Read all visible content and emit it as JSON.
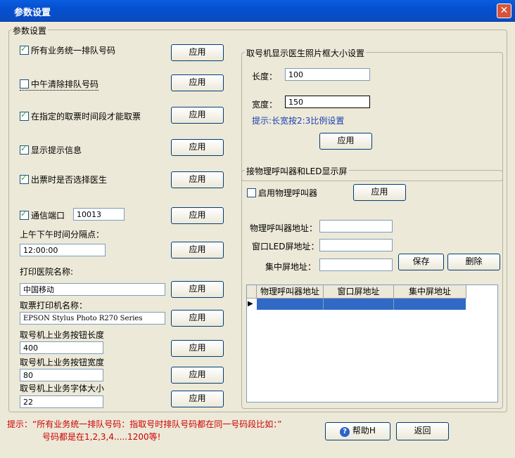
{
  "window": {
    "title": "参数设置",
    "close": "✕"
  },
  "left": {
    "group_label": "参数设置",
    "checks": [
      {
        "label": "所有业务统一排队号码",
        "checked": true
      },
      {
        "label": "中午清除排队号码",
        "checked": false
      },
      {
        "label": "在指定的取票时间段才能取票",
        "checked": true
      },
      {
        "label": "显示提示信息",
        "checked": true
      },
      {
        "label": "出票时是否选择医生",
        "checked": true
      },
      {
        "label": "通信端口",
        "checked": true
      }
    ],
    "port_value": "10013",
    "apply": "应用",
    "split_label": "上午下午时间分隔点：",
    "split_value": "12:00:00",
    "hospital_label": "打印医院名称:",
    "hospital_value": "中国移动",
    "printer_label": "取票打印机名称：",
    "printer_value": "EPSON Stylus Photo R270 Series",
    "btn_len_label": "取号机上业务按钮长度",
    "btn_len_value": "400",
    "btn_wid_label": "取号机上业务按钮宽度",
    "btn_wid_value": "80",
    "font_label": "取号机上业务字体大小",
    "font_value": "22"
  },
  "photo": {
    "group_label": "取号机显示医生照片框大小设置",
    "length_label": "长度：",
    "length_value": "100",
    "width_label": "宽度：",
    "width_value": "150",
    "hint": "提示:长宽按2:3比例设置",
    "apply": "应用"
  },
  "caller": {
    "group_label": "接物理呼叫器和LED显示屏",
    "enable_label": "启用物理呼叫器",
    "apply": "应用",
    "addr1_label": "物理呼叫器地址：",
    "addr2_label": "窗口LED屏地址：",
    "addr3_label": "集中屏地址：",
    "save": "保存",
    "delete": "删除",
    "columns": [
      "物理呼叫器地址",
      "窗口屏地址",
      "集中屏地址"
    ],
    "row_marker": "▶"
  },
  "footer": {
    "hint1": "提示：“所有业务统一排队号码：指取号时排队号码都在同一号码段比如：”",
    "hint2": "号码都是在1,2,3,4.....1200等!",
    "help": "帮助H",
    "back": "返回"
  }
}
